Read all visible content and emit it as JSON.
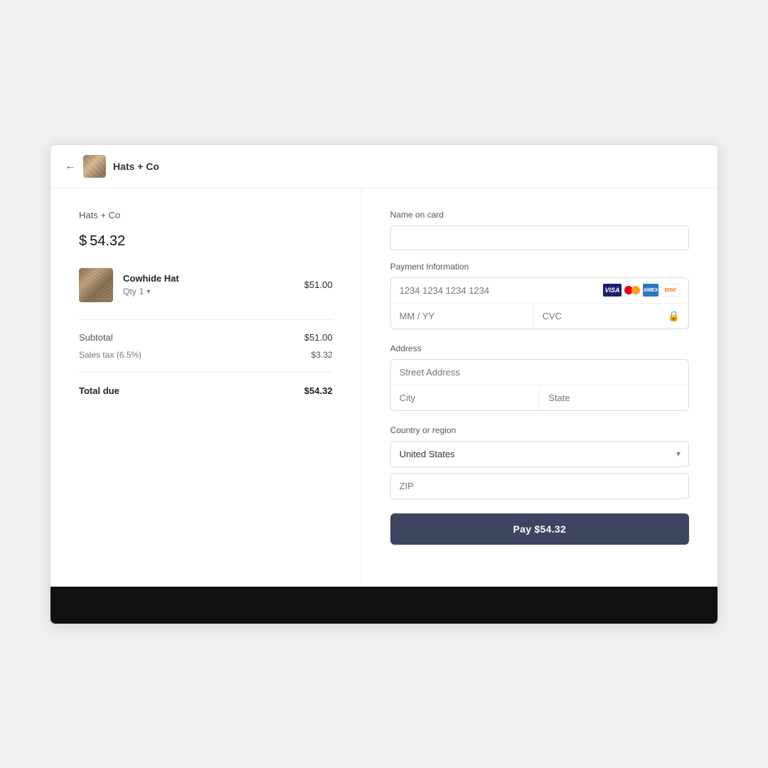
{
  "header": {
    "back_label": "←",
    "brand_name": "Hats + Co"
  },
  "left": {
    "store_name": "Hats + Co",
    "total_prefix": "$",
    "total_amount": "54.32",
    "product": {
      "name": "Cowhide Hat",
      "qty_label": "Qty",
      "qty_value": "1",
      "price": "$51.00"
    },
    "subtotal_label": "Subtotal",
    "subtotal_value": "$51.00",
    "tax_label": "Sales tax (6.5%)",
    "tax_value": "$3.32",
    "total_due_label": "Total due",
    "total_due_value": "$54.32"
  },
  "right": {
    "name_label": "Name on card",
    "name_placeholder": "",
    "payment_label": "Payment Information",
    "card_number_placeholder": "1234 1234 1234 1234",
    "expiry_placeholder": "MM / YY",
    "cvc_placeholder": "CVC",
    "address_label": "Address",
    "street_placeholder": "Street Address",
    "city_placeholder": "City",
    "state_placeholder": "State",
    "country_label": "Country or region",
    "country_value": "United States",
    "zip_placeholder": "ZIP",
    "pay_button_label": "Pay $54.32",
    "icons": {
      "visa": "VISA",
      "mastercard": "MC",
      "amex": "AMEX",
      "discover": "DISC"
    }
  }
}
